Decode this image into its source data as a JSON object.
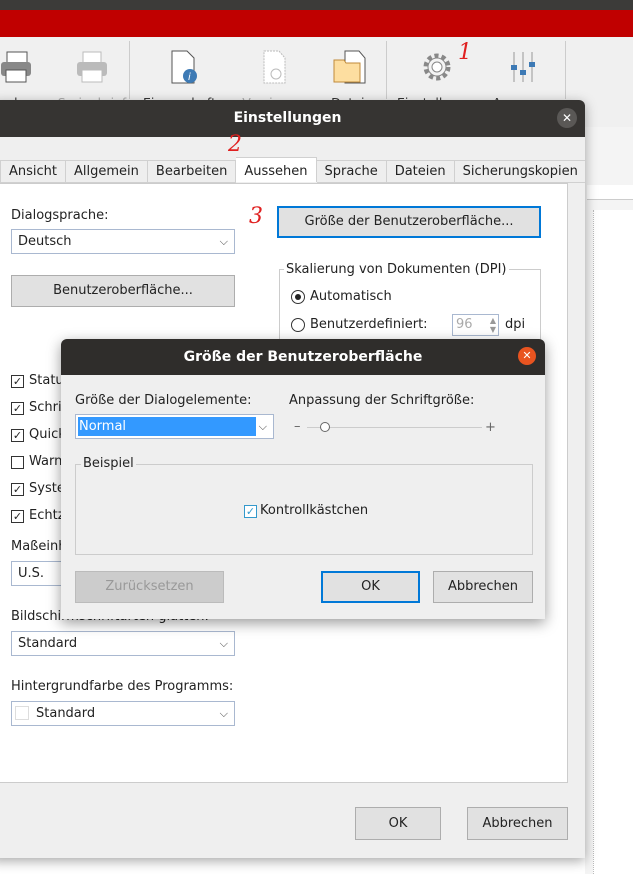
{
  "toolbar": {
    "items": [
      {
        "label": "Drucken",
        "visible_label": "ucken",
        "icon": "printer-icon",
        "enabled": true
      },
      {
        "label": "Serienbrief",
        "icon": "print-merge-icon",
        "enabled": false
      },
      {
        "label": "Eigenschaften",
        "icon": "document-info-icon",
        "enabled": true
      },
      {
        "label": "Versionen",
        "icon": "document-versions-icon",
        "enabled": false
      },
      {
        "label": "Datei-",
        "icon": "folder-document-icon",
        "enabled": true
      },
      {
        "label": "Einstellungen",
        "icon": "gear-icon",
        "enabled": true
      },
      {
        "label": "Anpassen",
        "icon": "sliders-icon",
        "enabled": true
      }
    ],
    "annotations": [
      "1",
      "2",
      "3"
    ]
  },
  "settings_dialog": {
    "title": "Einstellungen",
    "tabs": [
      "Ansicht",
      "Allgemein",
      "Bearbeiten",
      "Aussehen",
      "Sprache",
      "Dateien",
      "Sicherungskopien"
    ],
    "active_tab": "Aussehen",
    "dialog_language_label": "Dialogsprache:",
    "dialog_language_value": "Deutsch",
    "ui_button": "Benutzeroberfläche...",
    "ui_size_button": "Größe der Benutzeroberfläche...",
    "dpi_group": "Skalierung von Dokumenten (DPI)",
    "dpi_auto": "Automatisch",
    "dpi_custom": "Benutzerdefiniert:",
    "dpi_value": "96",
    "dpi_unit": "dpi",
    "checkboxes": [
      {
        "label": "Statu",
        "checked": true
      },
      {
        "label": "Schrif",
        "checked": true
      },
      {
        "label": "Quick",
        "checked": true
      },
      {
        "label": "Warn",
        "checked": false
      },
      {
        "label": "Syste",
        "checked": true
      },
      {
        "label": "Echtz",
        "checked": true
      }
    ],
    "units_label": "Maßeinh",
    "units_value": "U.S.",
    "smoothing_label": "Bildschirmschriftarten glätten:",
    "smoothing_value": "Standard",
    "bgcolor_label": "Hintergrundfarbe des Programms:",
    "bgcolor_value": "Standard",
    "ok": "OK",
    "cancel": "Abbrechen"
  },
  "ui_size_dialog": {
    "title": "Größe der Benutzeroberfläche",
    "elements_label": "Größe der Dialogelemente:",
    "elements_value": "Normal",
    "font_label": "Anpassung der Schriftgröße:",
    "font_scale": 0.1,
    "minus": "–",
    "plus": "+",
    "example_group": "Beispiel",
    "example_checkbox": "Kontrollkästchen",
    "reset": "Zurücksetzen",
    "ok": "OK",
    "cancel": "Abbrechen"
  }
}
